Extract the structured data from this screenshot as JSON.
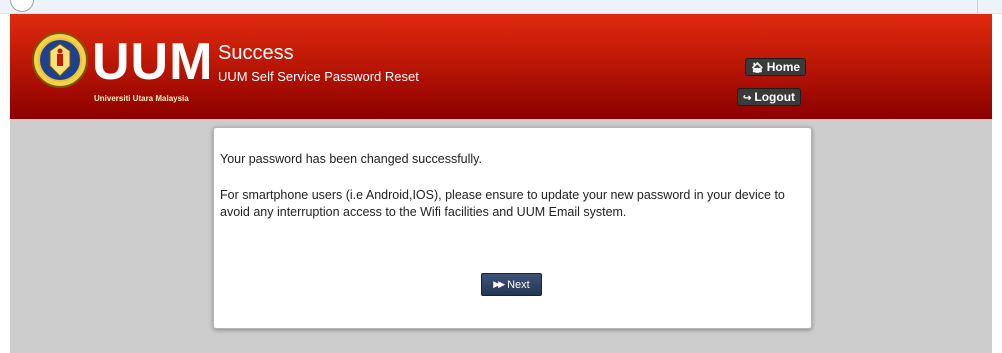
{
  "header": {
    "logo_text": "UUM",
    "logo_subtext": "Universiti Utara Malaysia",
    "title": "Success",
    "subtitle": "UUM Self Service Password Reset",
    "home_label": "Home",
    "logout_label": "Logout",
    "home_icon": "home-icon",
    "logout_icon": "logout-icon"
  },
  "panel": {
    "message_success": "Your password has been changed successfully.",
    "message_notice": "For smartphone users (i.e Android,IOS), please ensure to update your new password in your device to avoid any interruption access to the Wifi facilities and UUM Email system.",
    "next_label": "Next",
    "next_icon": "fast-forward-icon"
  },
  "colors": {
    "header_red": "#c11a06",
    "background_gray": "#cdcdcd",
    "button_navy": "#2c3f5f"
  }
}
